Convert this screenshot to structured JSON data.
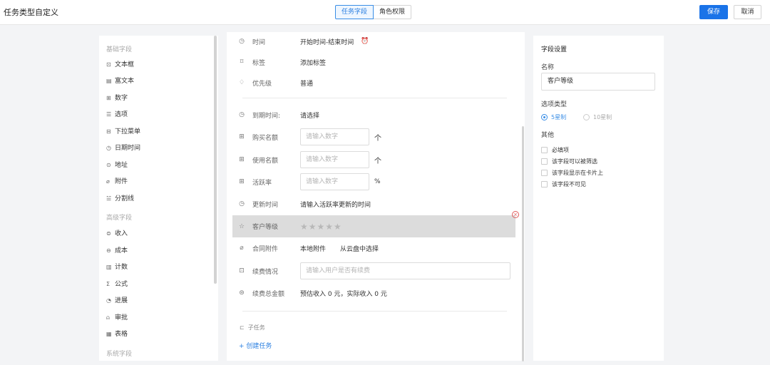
{
  "header": {
    "title": "任务类型自定义",
    "tabs": [
      {
        "label": "任务字段",
        "active": true
      },
      {
        "label": "角色权限",
        "active": false
      }
    ],
    "save_label": "保存",
    "cancel_label": "取消",
    "accent": "#1a73e8"
  },
  "left_panel": {
    "basic_group": "基础字段",
    "basic_items": [
      {
        "icon": "text-box-icon",
        "label": "文本框"
      },
      {
        "icon": "rich-text-icon",
        "label": "富文本"
      },
      {
        "icon": "number-icon",
        "label": "数字"
      },
      {
        "icon": "list-icon",
        "label": "选项"
      },
      {
        "icon": "dropdown-icon",
        "label": "下拉菜单"
      },
      {
        "icon": "clock-icon",
        "label": "日期时间"
      },
      {
        "icon": "location-icon",
        "label": "地址"
      },
      {
        "icon": "paperclip-icon",
        "label": "附件"
      },
      {
        "icon": "divider-icon",
        "label": "分割线"
      }
    ],
    "advanced_group": "高级字段",
    "advanced_items": [
      {
        "icon": "income-icon",
        "label": "收入"
      },
      {
        "icon": "cost-icon",
        "label": "成本"
      },
      {
        "icon": "count-icon",
        "label": "计数"
      },
      {
        "icon": "sigma-icon",
        "label": "公式"
      },
      {
        "icon": "progress-icon",
        "label": "进展"
      },
      {
        "icon": "user-icon",
        "label": "审批"
      },
      {
        "icon": "table-icon",
        "label": "表格"
      }
    ],
    "system_group": "系统字段"
  },
  "form": {
    "time": {
      "label": "时间",
      "value": "开始时间-结束时间"
    },
    "tags": {
      "label": "标签",
      "value": "添加标签"
    },
    "priority": {
      "label": "优先级",
      "value": "普通"
    },
    "due": {
      "label": "到期时间:",
      "value": "请选择"
    },
    "purchase": {
      "label": "购买名额",
      "placeholder": "请输入数字",
      "suffix": "个"
    },
    "usage": {
      "label": "使用名额",
      "placeholder": "请输入数字",
      "suffix": "个"
    },
    "activity": {
      "label": "活跃率",
      "placeholder": "请输入数字",
      "suffix": "%"
    },
    "update_time": {
      "label": "更新时间",
      "value": "请输入活跃率更新的时间"
    },
    "customer_level": {
      "label": "客户等级",
      "stars": "★★★★★",
      "rating": 0
    },
    "contract": {
      "label": "合同附件",
      "local": "本地附件",
      "cloud": "从云盘中选择"
    },
    "renewal": {
      "label": "续费情况",
      "placeholder": "请输入用户是否有续费"
    },
    "renewal_total": {
      "label": "续费总金额",
      "value": "预估收入 0 元，实际收入 0 元"
    },
    "subtask_label": "子任务",
    "create_task": "+ 创建任务"
  },
  "settings": {
    "title": "字段设置",
    "name_label": "名称",
    "name_value": "客户等级",
    "option_type_label": "选项类型",
    "options": [
      {
        "label": "5星制",
        "selected": true
      },
      {
        "label": "10星制",
        "selected": false
      }
    ],
    "other_label": "其他",
    "checks": [
      {
        "label": "必填项",
        "checked": false
      },
      {
        "label": "该字段可以被筛选",
        "checked": false
      },
      {
        "label": "该字段显示在卡片上",
        "checked": false
      },
      {
        "label": "该字段不可见",
        "checked": false
      }
    ]
  }
}
